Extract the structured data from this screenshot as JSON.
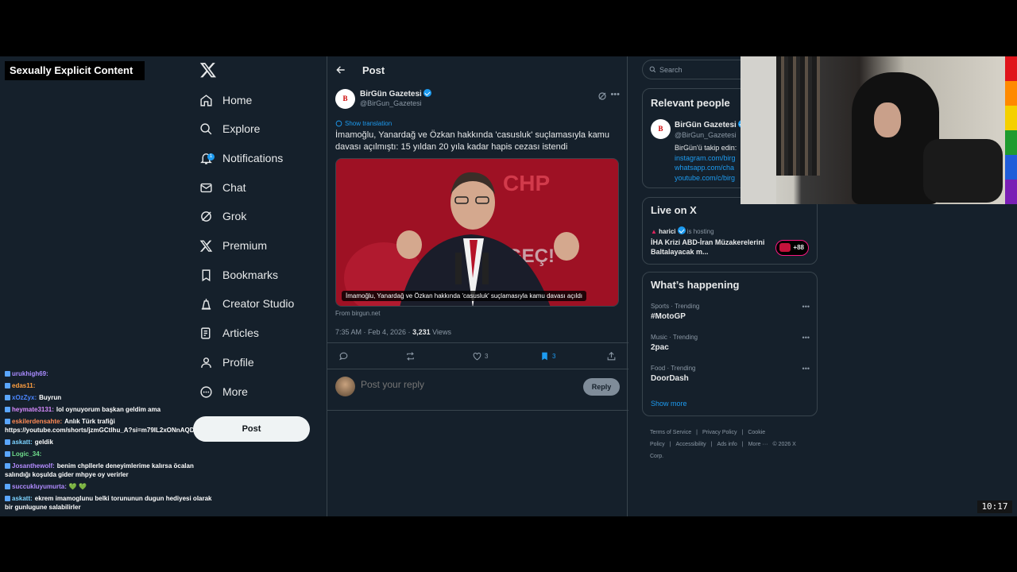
{
  "overlay": {
    "explicit_label": "Sexually Explicit Content",
    "clock": "10:17"
  },
  "chat": [
    {
      "user": "urukhigh69:",
      "color": "#a98bff",
      "text": ""
    },
    {
      "user": "edas11:",
      "color": "#ff9f40",
      "text": ""
    },
    {
      "user": "xOzZyx:",
      "color": "#4b86ff",
      "text": "Buyrun"
    },
    {
      "user": "heymate3131:",
      "color": "#d88bff",
      "text": "lol oynuyorum başkan geldim ama"
    },
    {
      "user": "eskilerdensahte:",
      "color": "#ff8a55",
      "text": "Anlık Türk trafiği https://youtube.com/shorts/jzmGCtlhu_A?si=m79IL2xONnAQD"
    },
    {
      "user": "askatt:",
      "color": "#7cd3ff",
      "text": "geldik"
    },
    {
      "user": "Logic_34:",
      "color": "#6fdc8c",
      "text": ""
    },
    {
      "user": "Josanthewolf:",
      "color": "#b48cff",
      "text": "benim chpllerle deneyimlerime kalırsa öcalan salındığı koşulda gider mhpye oy verirler"
    },
    {
      "user": "succukluyumurta:",
      "color": "#b08bff",
      "text": "💚 💚"
    },
    {
      "user": "askatt:",
      "color": "#7cd3ff",
      "text": "ekrem imamoglunu belki torununun dugun hediyesi olarak bir gunlugune salabilirler"
    }
  ],
  "nav": {
    "items": [
      {
        "label": "Home",
        "icon": "home-icon"
      },
      {
        "label": "Explore",
        "icon": "search-icon"
      },
      {
        "label": "Notifications",
        "icon": "bell-icon"
      },
      {
        "label": "Chat",
        "icon": "mail-icon"
      },
      {
        "label": "Grok",
        "icon": "grok-icon"
      },
      {
        "label": "Premium",
        "icon": "x-icon"
      },
      {
        "label": "Bookmarks",
        "icon": "bookmark-icon"
      },
      {
        "label": "Creator Studio",
        "icon": "creator-icon"
      },
      {
        "label": "Articles",
        "icon": "article-icon"
      },
      {
        "label": "Profile",
        "icon": "person-icon"
      },
      {
        "label": "More",
        "icon": "more-circle-icon"
      }
    ],
    "post_label": "Post",
    "notif_count": "1"
  },
  "main": {
    "title": "Post",
    "author": {
      "name": "BirGün Gazetesi",
      "handle": "@BirGun_Gazetesi",
      "avatar": "B"
    },
    "show_translation": "Show translation",
    "text": "İmamoğlu, Yanardağ ve Özkan hakkında 'casusluk' suçlamasıyla kamu davası açılmıştı: 15 yıldan 20 yıla kadar hapis cezası istendi",
    "media_caption": "İmamoğlu, Yanardağ ve Özkan hakkında 'casusluk' suçlamasıyla kamu davası açıldı",
    "source": "From birgun.net",
    "time": "7:35 AM · Feb 4, 2026 · ",
    "views_count": "3,231",
    "views_label": " Views",
    "likes": "3",
    "bookmarks": "3",
    "reply_placeholder": "Post your reply",
    "reply_button": "Reply"
  },
  "right": {
    "search_placeholder": "Search",
    "relevant_title": "Relevant people",
    "relevant": {
      "name": "BirGün Gazetesi",
      "handle": "@BirGun_Gazetesi",
      "bio": "BirGün'ü takip edin:",
      "links": [
        "instagram.com/birg",
        "whatsapp.com/cha",
        "youtube.com/c/birg"
      ]
    },
    "live_title": "Live on X",
    "live": {
      "host": "harici",
      "hosting": "is hosting",
      "title": "İHA Krizi ABD-İran Müzakerelerini Baltalayacak m...",
      "count": "+88"
    },
    "happening_title": "What’s happening",
    "trends": [
      {
        "category": "Sports · Trending",
        "name": "#MotoGP"
      },
      {
        "category": "Music · Trending",
        "name": "2pac"
      },
      {
        "category": "Food · Trending",
        "name": "DoorDash"
      }
    ],
    "show_more": "Show more",
    "footer": [
      "Terms of Service",
      "|",
      "Privacy Policy",
      "|",
      "Cookie Policy",
      "|",
      "Accessibility",
      "|",
      "Ads info",
      "|",
      "More ···",
      "© 2026 X Corp."
    ]
  },
  "colors": {
    "accent": "#1d9bf0",
    "background": "#15202b",
    "border": "#38444d",
    "live_ring": "#f91880"
  },
  "rainbow": [
    "#e0141b",
    "#ff8a00",
    "#f5d000",
    "#1e9b2f",
    "#1f5dd9",
    "#7a1fb5"
  ]
}
